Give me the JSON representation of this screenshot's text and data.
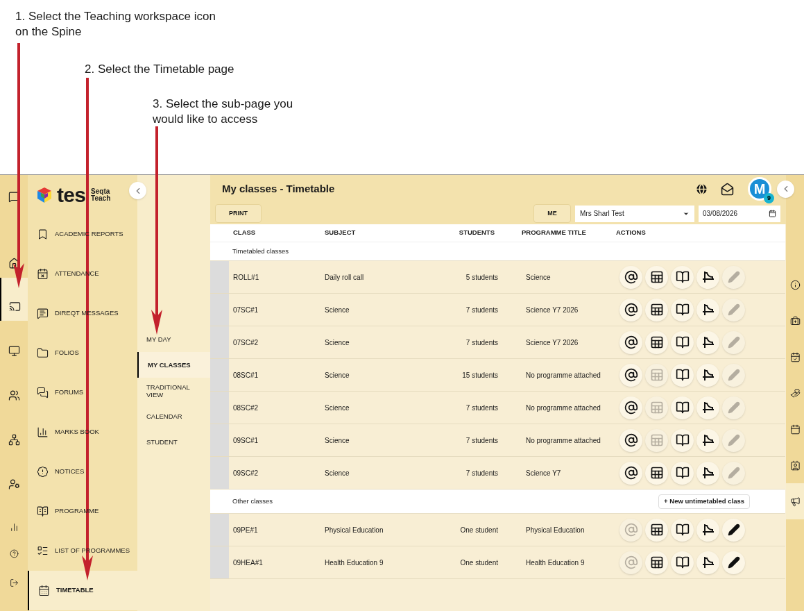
{
  "annotations": [
    {
      "text": "1. Select the Teaching workspace icon on the Spine"
    },
    {
      "text": "2. Select the Timetable page"
    },
    {
      "text": "3. Select the sub-page you would like to access"
    }
  ],
  "spine": [
    {
      "kind": "chat",
      "selected": false
    },
    {
      "kind": "home",
      "selected": false
    },
    {
      "kind": "teaching",
      "selected": true
    },
    {
      "kind": "screen",
      "selected": false
    },
    {
      "kind": "people",
      "selected": false
    },
    {
      "kind": "network",
      "selected": false
    },
    {
      "kind": "admin",
      "selected": false
    },
    {
      "kind": "chart",
      "selected": false
    },
    {
      "kind": "help",
      "selected": false
    },
    {
      "kind": "logout",
      "selected": false
    }
  ],
  "logo": {
    "wordmark": "tes",
    "product": [
      "Seqta",
      "Teach"
    ]
  },
  "menu": [
    {
      "label": "ACADEMIC REPORTS",
      "kind": "reports",
      "selected": false
    },
    {
      "label": "ATTENDANCE",
      "kind": "attendance",
      "selected": false
    },
    {
      "label": "DIREQT MESSAGES",
      "kind": "messages",
      "selected": false
    },
    {
      "label": "FOLIOS",
      "kind": "folios",
      "selected": false
    },
    {
      "label": "FORUMS",
      "kind": "forums",
      "selected": false
    },
    {
      "label": "MARKS BOOK",
      "kind": "marks",
      "selected": false
    },
    {
      "label": "NOTICES",
      "kind": "notices",
      "selected": false
    },
    {
      "label": "PROGRAMME",
      "kind": "programme",
      "selected": false
    },
    {
      "label": "LIST OF PROGRAMMES",
      "kind": "list",
      "selected": false
    },
    {
      "label": "TIMETABLE",
      "kind": "timetable",
      "selected": true
    }
  ],
  "submenu": [
    {
      "label": "MY DAY",
      "selected": false
    },
    {
      "label": "MY CLASSES",
      "selected": true
    },
    {
      "label": "TRADITIONAL VIEW",
      "selected": false
    },
    {
      "label": "CALENDAR",
      "selected": false
    },
    {
      "label": "STUDENT",
      "selected": false
    }
  ],
  "header": {
    "title": "My classes - Timetable",
    "avatar": {
      "initial": "M",
      "badge": "9"
    }
  },
  "toolbar": {
    "print": "PRINT",
    "me": "ME",
    "staff": "Mrs Sharl Test",
    "date": "03/08/2026"
  },
  "table": {
    "columns": [
      "CLASS",
      "SUBJECT",
      "STUDENTS",
      "PROGRAMME TITLE",
      "ACTIONS"
    ],
    "groups": [
      {
        "title": "Timetabled classes",
        "rows": [
          {
            "class": "ROLL#1",
            "subject": "Daily roll call",
            "students": "5 students",
            "programme": "Science",
            "actions": [
              {
                "kind": "email",
                "disabled": false
              },
              {
                "kind": "marks",
                "disabled": false
              },
              {
                "kind": "book",
                "disabled": false
              },
              {
                "kind": "chart",
                "disabled": false
              },
              {
                "kind": "edit",
                "disabled": true
              }
            ]
          },
          {
            "class": "07SC#1",
            "subject": "Science",
            "students": "7 students",
            "programme": "Science Y7 2026",
            "actions": [
              {
                "kind": "email",
                "disabled": false
              },
              {
                "kind": "marks",
                "disabled": false
              },
              {
                "kind": "book",
                "disabled": false
              },
              {
                "kind": "chart",
                "disabled": false
              },
              {
                "kind": "edit",
                "disabled": true
              }
            ]
          },
          {
            "class": "07SC#2",
            "subject": "Science",
            "students": "7 students",
            "programme": "Science Y7 2026",
            "actions": [
              {
                "kind": "email",
                "disabled": false
              },
              {
                "kind": "marks",
                "disabled": false
              },
              {
                "kind": "book",
                "disabled": false
              },
              {
                "kind": "chart",
                "disabled": false
              },
              {
                "kind": "edit",
                "disabled": true
              }
            ]
          },
          {
            "class": "08SC#1",
            "subject": "Science",
            "students": "15 students",
            "programme": "No programme attached",
            "actions": [
              {
                "kind": "email",
                "disabled": false
              },
              {
                "kind": "marks",
                "disabled": true
              },
              {
                "kind": "book",
                "disabled": false
              },
              {
                "kind": "chart",
                "disabled": false
              },
              {
                "kind": "edit",
                "disabled": true
              }
            ]
          },
          {
            "class": "08SC#2",
            "subject": "Science",
            "students": "7 students",
            "programme": "No programme attached",
            "actions": [
              {
                "kind": "email",
                "disabled": false
              },
              {
                "kind": "marks",
                "disabled": true
              },
              {
                "kind": "book",
                "disabled": false
              },
              {
                "kind": "chart",
                "disabled": false
              },
              {
                "kind": "edit",
                "disabled": true
              }
            ]
          },
          {
            "class": "09SC#1",
            "subject": "Science",
            "students": "7 students",
            "programme": "No programme attached",
            "actions": [
              {
                "kind": "email",
                "disabled": false
              },
              {
                "kind": "marks",
                "disabled": true
              },
              {
                "kind": "book",
                "disabled": false
              },
              {
                "kind": "chart",
                "disabled": false
              },
              {
                "kind": "edit",
                "disabled": true
              }
            ]
          },
          {
            "class": "09SC#2",
            "subject": "Science",
            "students": "7 students",
            "programme": "Science Y7",
            "actions": [
              {
                "kind": "email",
                "disabled": false
              },
              {
                "kind": "marks",
                "disabled": false
              },
              {
                "kind": "book",
                "disabled": false
              },
              {
                "kind": "chart",
                "disabled": false
              },
              {
                "kind": "edit",
                "disabled": true
              }
            ]
          }
        ]
      },
      {
        "title": "Other classes",
        "button": "+ New untimetabled class",
        "rows": [
          {
            "class": "09PE#1",
            "subject": "Physical Education",
            "students": "One student",
            "programme": "Physical Education",
            "actions": [
              {
                "kind": "email",
                "disabled": true
              },
              {
                "kind": "marks",
                "disabled": false
              },
              {
                "kind": "book",
                "disabled": false
              },
              {
                "kind": "chart",
                "disabled": false
              },
              {
                "kind": "edit",
                "disabled": false
              }
            ]
          },
          {
            "class": "09HEA#1",
            "subject": "Health Education 9",
            "students": "One student",
            "programme": "Health Education 9",
            "actions": [
              {
                "kind": "email",
                "disabled": true
              },
              {
                "kind": "marks",
                "disabled": false
              },
              {
                "kind": "book",
                "disabled": false
              },
              {
                "kind": "chart",
                "disabled": false
              },
              {
                "kind": "edit",
                "disabled": false
              }
            ]
          }
        ]
      }
    ]
  },
  "right_rail": [
    {
      "kind": "info",
      "selected": false
    },
    {
      "kind": "medical",
      "selected": false
    },
    {
      "kind": "attendance",
      "selected": false
    },
    {
      "kind": "care",
      "selected": false
    },
    {
      "kind": "calendar",
      "selected": false
    },
    {
      "kind": "profile",
      "selected": false
    },
    {
      "kind": "notices",
      "selected": true
    }
  ]
}
